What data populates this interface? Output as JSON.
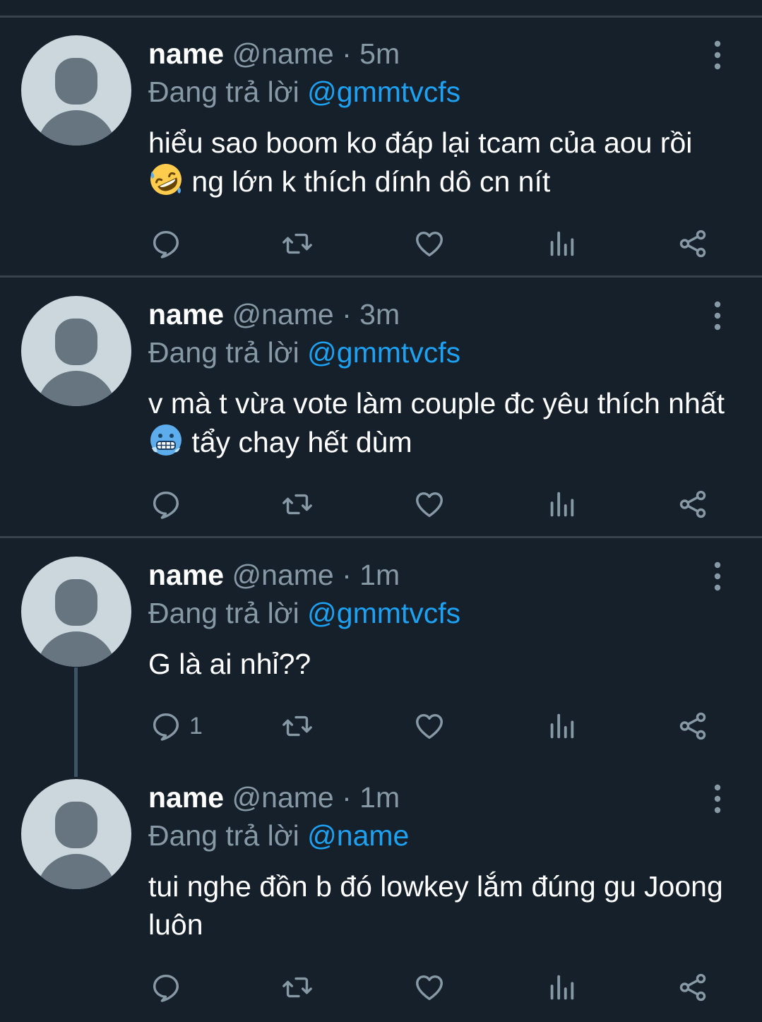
{
  "colors": {
    "background": "#15202b",
    "divider": "#38444d",
    "secondary_text": "#8899a6",
    "mention": "#1da1f2"
  },
  "tweets": [
    {
      "name": "name",
      "handle": "@name",
      "separator": "·",
      "time": "5m",
      "reply_prefix": "Đang trả lời",
      "reply_to": "@gmmtvcfs",
      "text_before_emoji": "hiểu sao boom ko đáp lại tcam của aou rồi",
      "emoji": "rolling-on-floor-laughing-emoji",
      "text_after_emoji": "ng lớn k thích dính dô cn nít",
      "reply_count": ""
    },
    {
      "name": "name",
      "handle": "@name",
      "separator": "·",
      "time": "3m",
      "reply_prefix": "Đang trả lời",
      "reply_to": "@gmmtvcfs",
      "text_before_emoji": "v mà t vừa vote làm couple đc yêu thích nhất",
      "emoji": "cold-face-emoji",
      "text_after_emoji": "tẩy chay hết dùm",
      "reply_count": ""
    },
    {
      "name": "name",
      "handle": "@name",
      "separator": "·",
      "time": "1m",
      "reply_prefix": "Đang trả lời",
      "reply_to": "@gmmtvcfs",
      "text": "G là ai nhỉ??",
      "reply_count": "1"
    },
    {
      "name": "name",
      "handle": "@name",
      "separator": "·",
      "time": "1m",
      "reply_prefix": "Đang trả lời",
      "reply_to": "@name",
      "text": "tui nghe đồn b đó lowkey lắm đúng gu Joong luôn",
      "reply_count": ""
    }
  ],
  "action_icons": [
    "reply-icon",
    "retweet-icon",
    "like-icon",
    "analytics-icon",
    "share-icon"
  ]
}
